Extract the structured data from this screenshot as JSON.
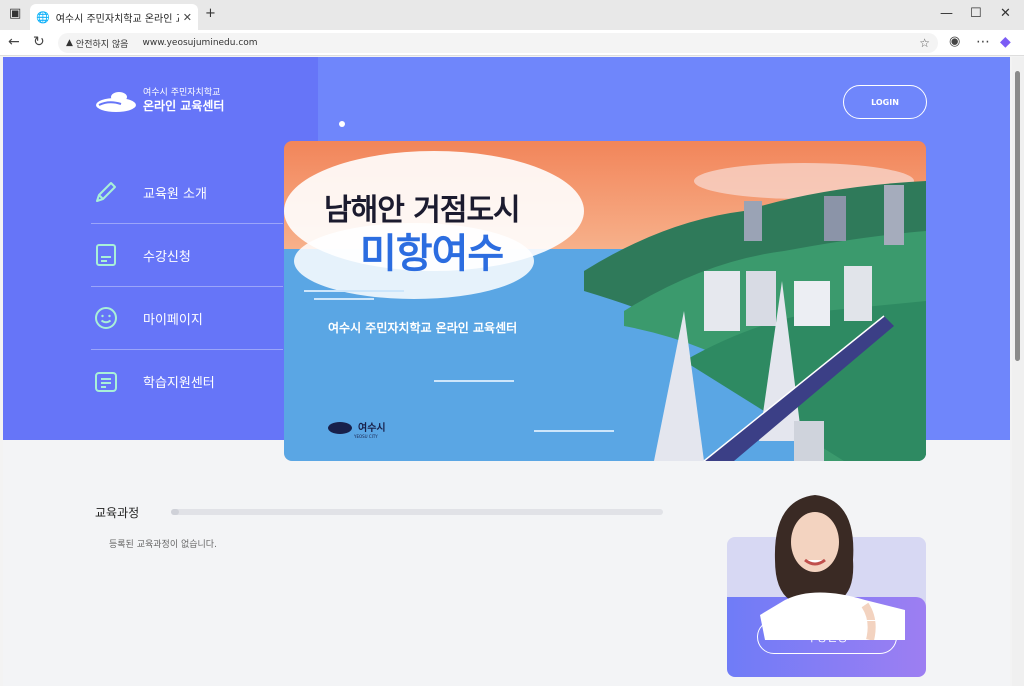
{
  "browser": {
    "tab_title": "여수시 주민자치학교 온라인 교육",
    "insecure_label": "안전하지 않음",
    "url": "www.yeosujuminedu.com"
  },
  "site": {
    "logo_top": "여수시 주민자치학교",
    "logo_bottom": "온라인 교육센터",
    "login_label": "LOGIN"
  },
  "menu": [
    {
      "label": "교육원 소개",
      "icon": "pencil-icon"
    },
    {
      "label": "수강신청",
      "icon": "notebook-icon"
    },
    {
      "label": "마이페이지",
      "icon": "smiley-icon"
    },
    {
      "label": "학습지원센터",
      "icon": "support-icon"
    }
  ],
  "banner": {
    "line1": "남해안 거점도시",
    "line2": "미항여수",
    "subtitle": "여수시 주민자치학교 온라인 교육센터",
    "city_ko": "여수시",
    "city_en": "YEOSU CITY"
  },
  "courses": {
    "title": "교육과정",
    "empty_message": "등록된 교육과정이 없습니다."
  },
  "promo": {
    "button_label": "수강신청"
  },
  "colors": {
    "hero_left": "#6675f8",
    "hero_right": "#6f86fb",
    "accent": "#2c6de0"
  }
}
